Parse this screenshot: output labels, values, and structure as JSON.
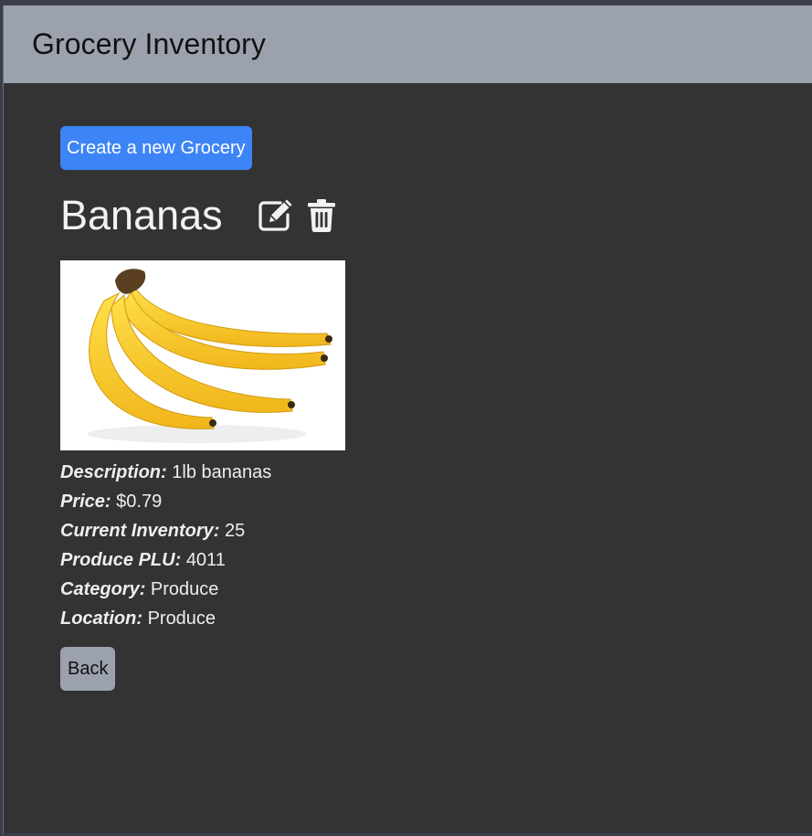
{
  "app": {
    "title": "Grocery Inventory"
  },
  "actions": {
    "create_label": "Create a new Grocery",
    "back_label": "Back"
  },
  "item": {
    "name": "Bananas",
    "image_alt": "Bananas",
    "details": [
      {
        "label": "Description:",
        "value": "1lb bananas"
      },
      {
        "label": "Price:",
        "value": "$0.79"
      },
      {
        "label": "Current Inventory:",
        "value": "25"
      },
      {
        "label": "Produce PLU:",
        "value": "4011"
      },
      {
        "label": "Category:",
        "value": "Produce"
      },
      {
        "label": "Location:",
        "value": "Produce"
      }
    ]
  },
  "icons": {
    "edit": "edit-icon",
    "delete": "trash-icon"
  },
  "colors": {
    "navbar": "#9ca1ae",
    "background": "#333333",
    "primary_button": "#3d84f6",
    "secondary_button": "#9ca1ae"
  }
}
